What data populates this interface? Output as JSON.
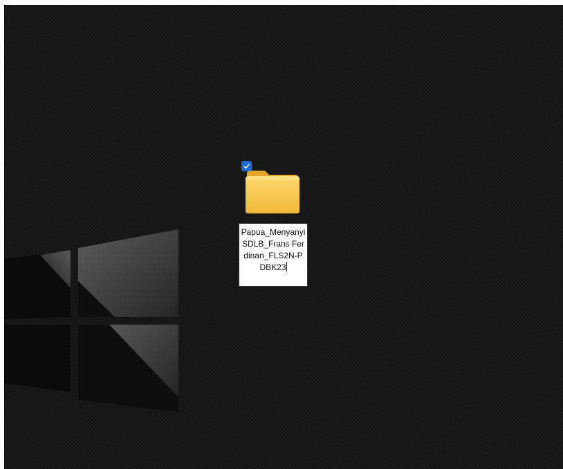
{
  "desktop": {
    "wallpaper": "windows-logo-dark-striped",
    "background_color": "#151515"
  },
  "icon": {
    "type": "folder-icon",
    "selected": true,
    "checkbox_color": "#1a6ad6",
    "folder_color": "#f4c247",
    "rename_text": "Papua_Menyanyi SDLB_Frans Ferdinan_FLS2N-PDBK23"
  }
}
